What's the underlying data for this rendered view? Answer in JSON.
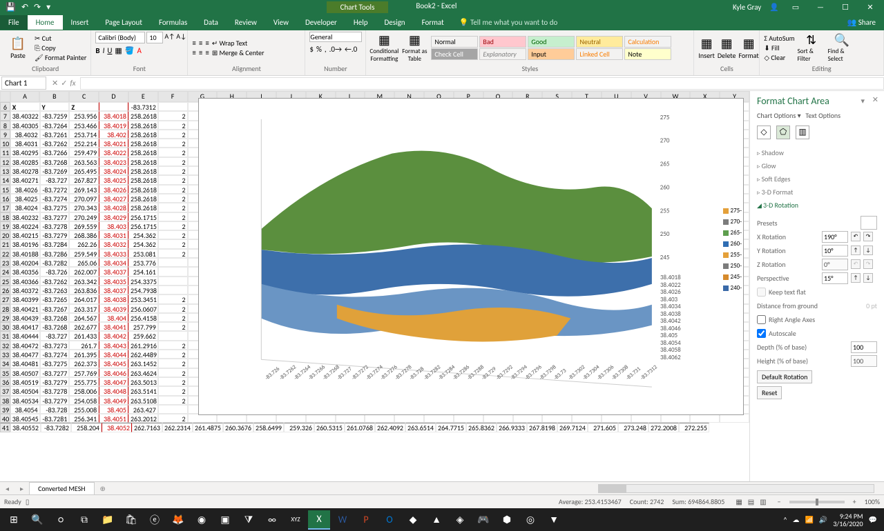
{
  "titlebar": {
    "chart_tools": "Chart Tools",
    "doc": "Book2 - Excel",
    "user": "Kyle Gray"
  },
  "tabs": [
    "File",
    "Home",
    "Insert",
    "Page Layout",
    "Formulas",
    "Data",
    "Review",
    "View",
    "Developer",
    "Help",
    "Design",
    "Format"
  ],
  "tellme": "Tell me what you want to do",
  "share": "Share",
  "ribbon": {
    "clipboard": {
      "paste": "Paste",
      "cut": "Cut",
      "copy": "Copy",
      "fp": "Format Painter",
      "label": "Clipboard"
    },
    "font": {
      "name": "Calibri (Body)",
      "size": "10",
      "label": "Font"
    },
    "align": {
      "wrap": "Wrap Text",
      "merge": "Merge & Center",
      "label": "Alignment"
    },
    "number": {
      "fmt": "General",
      "label": "Number"
    },
    "stylesg": {
      "cf": "Conditional Formatting",
      "fat": "Format as Table",
      "label": "Styles",
      "cells": [
        [
          "Normal",
          "Bad",
          "Good",
          "Neutral",
          "Calculation"
        ],
        [
          "Check Cell",
          "Explanatory ...",
          "Input",
          "Linked Cell",
          "Note"
        ]
      ]
    },
    "cells": {
      "ins": "Insert",
      "del": "Delete",
      "fmt": "Format",
      "label": "Cells"
    },
    "editing": {
      "sum": "AutoSum",
      "fill": "Fill",
      "clear": "Clear",
      "sort": "Sort & Filter",
      "find": "Find & Select",
      "label": "Editing"
    }
  },
  "namebox": "Chart 1",
  "cols": [
    "A",
    "B",
    "C",
    "D",
    "E",
    "F",
    "G",
    "H",
    "I",
    "J",
    "K",
    "L",
    "M",
    "N",
    "O",
    "P",
    "Q",
    "R",
    "S",
    "T",
    "U",
    "V",
    "W",
    "X",
    "Y"
  ],
  "header_row": [
    "X",
    "Y",
    "Z"
  ],
  "top_e": "-83.7312",
  "rows": [
    [
      7,
      "38.40322",
      "-83.7259",
      "253.956",
      "38.4018",
      "258.2618",
      "2"
    ],
    [
      8,
      "38.40305",
      "-83.7264",
      "253.466",
      "38.4019",
      "258.2618",
      "2"
    ],
    [
      9,
      "38.4032",
      "-83.7261",
      "253.714",
      "38.402",
      "258.2618",
      "2"
    ],
    [
      10,
      "38.4031",
      "-83.7262",
      "252.214",
      "38.4021",
      "258.2618",
      "2"
    ],
    [
      11,
      "38.40295",
      "-83.7266",
      "259.479",
      "38.4022",
      "258.2618",
      "2"
    ],
    [
      12,
      "38.40285",
      "-83.7268",
      "263.563",
      "38.4023",
      "258.2618",
      "2"
    ],
    [
      13,
      "38.40278",
      "-83.7269",
      "265.495",
      "38.4024",
      "258.2618",
      "2"
    ],
    [
      14,
      "38.40271",
      "-83.727",
      "267.827",
      "38.4025",
      "258.2618",
      "2"
    ],
    [
      15,
      "38.4026",
      "-83.7272",
      "269.143",
      "38.4026",
      "258.2618",
      "2"
    ],
    [
      16,
      "38.4025",
      "-83.7274",
      "270.097",
      "38.4027",
      "258.2618",
      "2"
    ],
    [
      17,
      "38.4024",
      "-83.7275",
      "270.343",
      "38.4028",
      "258.2618",
      "2"
    ],
    [
      18,
      "38.40232",
      "-83.7277",
      "270.249",
      "38.4029",
      "256.1715",
      "2"
    ],
    [
      19,
      "38.40224",
      "-83.7278",
      "269.559",
      "38.403",
      "256.1715",
      "2"
    ],
    [
      20,
      "38.40215",
      "-83.7279",
      "268.386",
      "38.4031",
      "254.362",
      "2"
    ],
    [
      21,
      "38.40196",
      "-83.7284",
      "262.26",
      "38.4032",
      "254.362",
      "2"
    ],
    [
      22,
      "38.40188",
      "-83.7286",
      "259.549",
      "38.4033",
      "253.081",
      "2"
    ],
    [
      23,
      "38.40204",
      "-83.7282",
      "265.06",
      "38.4034",
      "253.776",
      ""
    ],
    [
      24,
      "38.40356",
      "-83.726",
      "262.007",
      "38.4037",
      "254.161",
      ""
    ],
    [
      25,
      "38.40366",
      "-83.7262",
      "263.342",
      "38.4035",
      "254.3375",
      ""
    ],
    [
      26,
      "38.40372",
      "-83.7263",
      "263.836",
      "38.4037",
      "254.7938",
      ""
    ],
    [
      27,
      "38.40399",
      "-83.7265",
      "264.017",
      "38.4038",
      "253.3451",
      "2"
    ],
    [
      28,
      "38.40421",
      "-83.7267",
      "263.317",
      "38.4039",
      "256.0607",
      "2"
    ],
    [
      29,
      "38.40439",
      "-83.7268",
      "264.567",
      "38.404",
      "256.4158",
      "2"
    ],
    [
      30,
      "38.40417",
      "-83.7268",
      "262.677",
      "38.4041",
      "257.799",
      "2"
    ],
    [
      31,
      "38.40444",
      "-83.727",
      "261.433",
      "38.4042",
      "259.662",
      ""
    ],
    [
      32,
      "38.40472",
      "-83.7273",
      "261.7",
      "38.4043",
      "261.2916",
      "2"
    ],
    [
      33,
      "38.40477",
      "-83.7274",
      "261.395",
      "38.4044",
      "262.4489",
      "2"
    ],
    [
      34,
      "38.40481",
      "-83.7275",
      "262.373",
      "38.4045",
      "263.1452",
      "2"
    ],
    [
      35,
      "38.40507",
      "-83.7277",
      "257.769",
      "38.4046",
      "263.4624",
      "2"
    ],
    [
      36,
      "38.40519",
      "-83.7279",
      "255.775",
      "38.4047",
      "263.5013",
      "2"
    ],
    [
      37,
      "38.40504",
      "-83.7278",
      "258.006",
      "38.4048",
      "263.5141",
      "2"
    ],
    [
      38,
      "38.40534",
      "-83.7279",
      "254.058",
      "38.4049",
      "263.5108",
      "2"
    ],
    [
      39,
      "38.4054",
      "-83.728",
      "255.008",
      "38.405",
      "263.427",
      ""
    ],
    [
      40,
      "38.40545",
      "-83.7281",
      "256.341",
      "38.4051",
      "263.2012",
      "2"
    ]
  ],
  "row41": [
    "41",
    "38.40552",
    "-83.7282",
    "258.204",
    "38.4052",
    "262.7163",
    "262.2314",
    "261.4875",
    "260.3676",
    "258.6499",
    "259.326",
    "260.5315",
    "261.0768",
    "262.4092",
    "263.6514",
    "264.7715",
    "265.8362",
    "266.9333",
    "267.8198",
    "269.7124",
    "271.605",
    "273.248",
    "272.2008",
    "272.255"
  ],
  "chart": {
    "y_ticks": [
      "275",
      "270",
      "265",
      "260",
      "255",
      "250",
      "245"
    ],
    "legend": [
      [
        "275-",
        "#e4a03a"
      ],
      [
        "270-",
        "#7c7c7c"
      ],
      [
        "265-",
        "#5e9e4e"
      ],
      [
        "260-",
        "#2f6db3"
      ],
      [
        "255-",
        "#e4a03a"
      ],
      [
        "250-",
        "#7c7c7c"
      ],
      [
        "245-",
        "#d68a2c"
      ],
      [
        "240-",
        "#3a6aa8"
      ]
    ],
    "z_labels": [
      "38.4018",
      "38.4022",
      "38.4026",
      "38.403",
      "38.4034",
      "38.4038",
      "38.4042",
      "38.4046",
      "38.405",
      "38.4054",
      "38.4058",
      "38.4062"
    ],
    "x_ticks": [
      "-83.726",
      "-83.7262",
      "-83.7264",
      "-83.7266",
      "-83.7268",
      "-83.727",
      "-83.7272",
      "-83.7274",
      "-83.7276",
      "-83.7278",
      "-83.728",
      "-83.7282",
      "-83.7284",
      "-83.7286",
      "-83.7288",
      "-83.729",
      "-83.7292",
      "-83.7294",
      "-83.7296",
      "-83.7298",
      "-83.73",
      "-83.7302",
      "-83.7304",
      "-83.7306",
      "-83.7308",
      "-83.731",
      "-83.7312"
    ]
  },
  "pane": {
    "title": "Format Chart Area",
    "chart_opts": "Chart Options",
    "text_opts": "Text Options",
    "sections": [
      "Shadow",
      "Glow",
      "Soft Edges",
      "3-D Format",
      "3-D Rotation"
    ],
    "presets": "Presets",
    "xrot": "X Rotation",
    "xval": "190°",
    "yrot": "Y Rotation",
    "yval": "10°",
    "zrot": "Z Rotation",
    "zval": "0°",
    "persp": "Perspective",
    "pval": "15°",
    "keepflat": "Keep text flat",
    "dist": "Distance from ground",
    "distval": "0 pt",
    "raa": "Right Angle Axes",
    "auto": "Autoscale",
    "depth": "Depth (% of base)",
    "depthval": "100",
    "height": "Height (% of base)",
    "heightval": "100",
    "defrot": "Default Rotation",
    "reset": "Reset"
  },
  "wstab": "Converted MESH",
  "status": {
    "ready": "Ready",
    "avg": "Average: 253.4153467",
    "count": "Count: 2742",
    "sum": "Sum: 694864.8805",
    "zoom": "100%"
  },
  "tray": {
    "time": "9:24 PM",
    "date": "3/16/2020"
  }
}
